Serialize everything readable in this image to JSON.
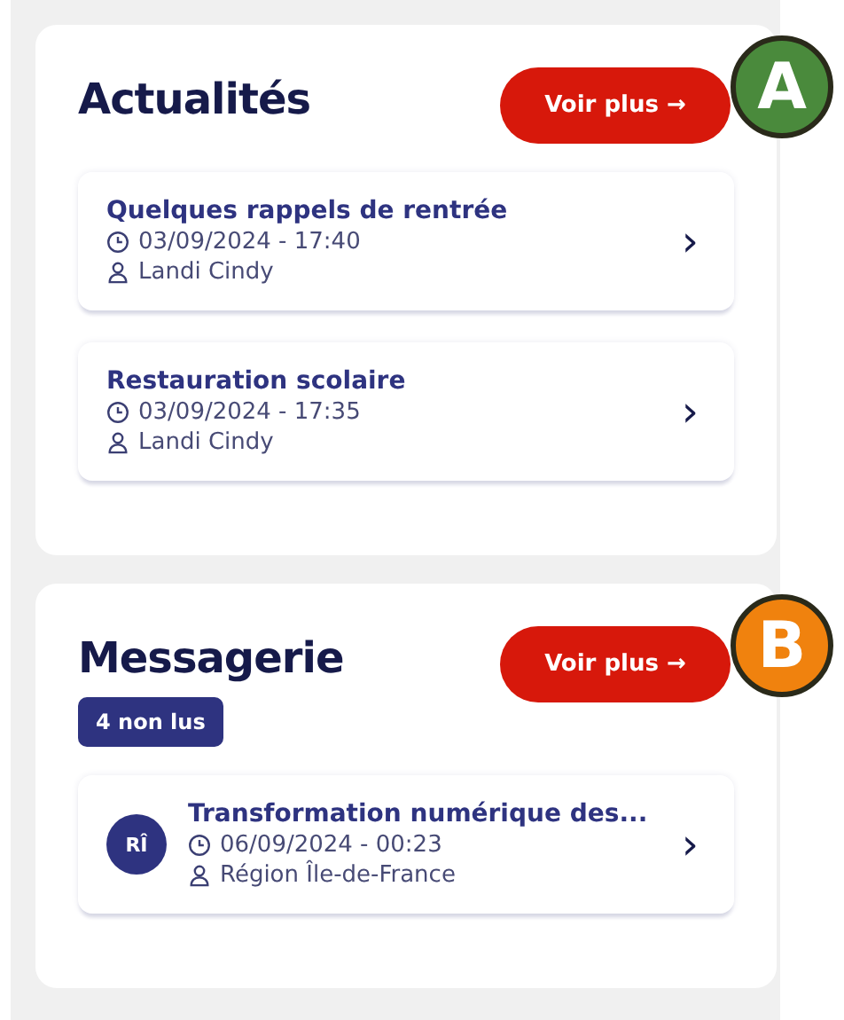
{
  "sections": [
    {
      "title": "Actualités",
      "button": "Voir plus →",
      "marker": {
        "label": "A",
        "color": "#4a8a3c"
      },
      "items": [
        {
          "title": "Quelques rappels de rentrée",
          "date": "03/09/2024 - 17:40",
          "author": "Landi Cindy",
          "chevron": "›"
        },
        {
          "title": "Restauration scolaire",
          "date": "03/09/2024 - 17:35",
          "author": "Landi Cindy",
          "chevron": "›"
        }
      ]
    },
    {
      "title": "Messagerie",
      "button": "Voir plus →",
      "badge": "4 non lus",
      "marker": {
        "label": "B",
        "color": "#f0820e"
      },
      "items": [
        {
          "avatar": "RÎ",
          "title": "Transformation numérique des...",
          "date": "06/09/2024 - 00:23",
          "author": "Région Île-de-France",
          "chevron": "›"
        }
      ]
    }
  ]
}
